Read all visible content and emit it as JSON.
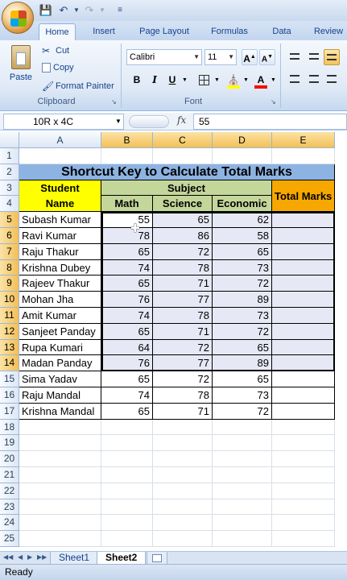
{
  "tabs": [
    "Home",
    "Insert",
    "Page Layout",
    "Formulas",
    "Data",
    "Review"
  ],
  "clipboard": {
    "paste": "Paste",
    "cut": "Cut",
    "copy": "Copy",
    "format_painter": "Format Painter",
    "group_label": "Clipboard"
  },
  "font": {
    "name": "Calibri",
    "size": "11",
    "group_label": "Font",
    "bold": "B",
    "italic": "I",
    "underline": "U",
    "grow": "A",
    "shrink": "A",
    "color_letter": "A"
  },
  "formula_bar": {
    "name_box": "10R x 4C",
    "fx": "fx",
    "value": "55"
  },
  "columns": [
    "A",
    "B",
    "C",
    "D",
    "E"
  ],
  "rows": [
    "1",
    "2",
    "3",
    "4",
    "5",
    "6",
    "7",
    "8",
    "9",
    "10",
    "11",
    "12",
    "13",
    "14",
    "15",
    "16",
    "17",
    "18",
    "19",
    "20",
    "21",
    "22",
    "23",
    "24",
    "25"
  ],
  "sheet": {
    "title": "Shortcut Key to Calculate Total Marks",
    "header_student": "Student",
    "header_name": "Name",
    "header_subject": "Subject",
    "header_total": "Total Marks",
    "subjects": [
      "Math",
      "Science",
      "Economic"
    ],
    "students": [
      {
        "name": "Subash Kumar",
        "math": "55",
        "science": "65",
        "economic": "62"
      },
      {
        "name": "Ravi Kumar",
        "math": "78",
        "science": "86",
        "economic": "58"
      },
      {
        "name": "Raju Thakur",
        "math": "65",
        "science": "72",
        "economic": "65"
      },
      {
        "name": "Krishna Dubey",
        "math": "74",
        "science": "78",
        "economic": "73"
      },
      {
        "name": "Rajeev Thakur",
        "math": "65",
        "science": "71",
        "economic": "72"
      },
      {
        "name": "Mohan Jha",
        "math": "76",
        "science": "77",
        "economic": "89"
      },
      {
        "name": "Amit Kumar",
        "math": "74",
        "science": "78",
        "economic": "73"
      },
      {
        "name": "Sanjeet Panday",
        "math": "65",
        "science": "71",
        "economic": "72"
      },
      {
        "name": "Rupa Kumari",
        "math": "64",
        "science": "72",
        "economic": "65"
      },
      {
        "name": "Madan Panday",
        "math": "76",
        "science": "77",
        "economic": "89"
      },
      {
        "name": "Sima Yadav",
        "math": "65",
        "science": "72",
        "economic": "65"
      },
      {
        "name": "Raju Mandal",
        "math": "74",
        "science": "78",
        "economic": "73"
      },
      {
        "name": "Krishna Mandal",
        "math": "65",
        "science": "71",
        "economic": "72"
      }
    ]
  },
  "sheet_tabs": [
    "Sheet1",
    "Sheet2"
  ],
  "active_sheet": "Sheet2",
  "status": "Ready",
  "colors": {
    "title_band": "#8db3e2",
    "student_header": "#ffff00",
    "subject_header": "#c4d79b",
    "total_header": "#f7a800",
    "selection": "#e6e9f5",
    "selected_header": "#f3bf55"
  }
}
